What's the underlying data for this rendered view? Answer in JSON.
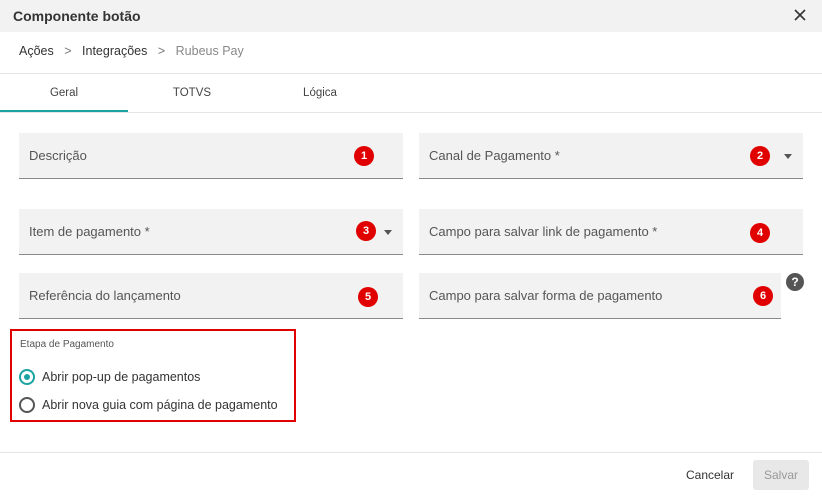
{
  "window": {
    "title": "Componente botão"
  },
  "breadcrumb": {
    "items": [
      "Ações",
      "Integrações",
      "Rubeus Pay"
    ],
    "separator": ">"
  },
  "tabs": [
    {
      "label": "Geral",
      "active": true
    },
    {
      "label": "TOTVS",
      "active": false
    },
    {
      "label": "Lógica",
      "active": false
    }
  ],
  "fields": {
    "descricao": {
      "label": "Descrição",
      "badge": "1"
    },
    "canal": {
      "label": "Canal de Pagamento *",
      "badge": "2"
    },
    "item": {
      "label": "Item de pagamento *",
      "badge": "3"
    },
    "link": {
      "label": "Campo para salvar link de pagamento *",
      "badge": "4"
    },
    "referencia": {
      "label": "Referência do lançamento",
      "badge": "5"
    },
    "forma": {
      "label": "Campo para salvar forma de pagamento",
      "badge": "6"
    }
  },
  "help": {
    "symbol": "?"
  },
  "etapa": {
    "title": "Etapa de Pagamento",
    "options": [
      {
        "label": "Abrir pop-up de pagamentos",
        "checked": true
      },
      {
        "label": "Abrir nova guia com página de pagamento",
        "checked": false
      }
    ]
  },
  "footer": {
    "cancel_label": "Cancelar",
    "save_label": "Salvar"
  },
  "colors": {
    "accent": "#1aa3a3",
    "badge": "#e00000",
    "highlight": "#e00000"
  }
}
